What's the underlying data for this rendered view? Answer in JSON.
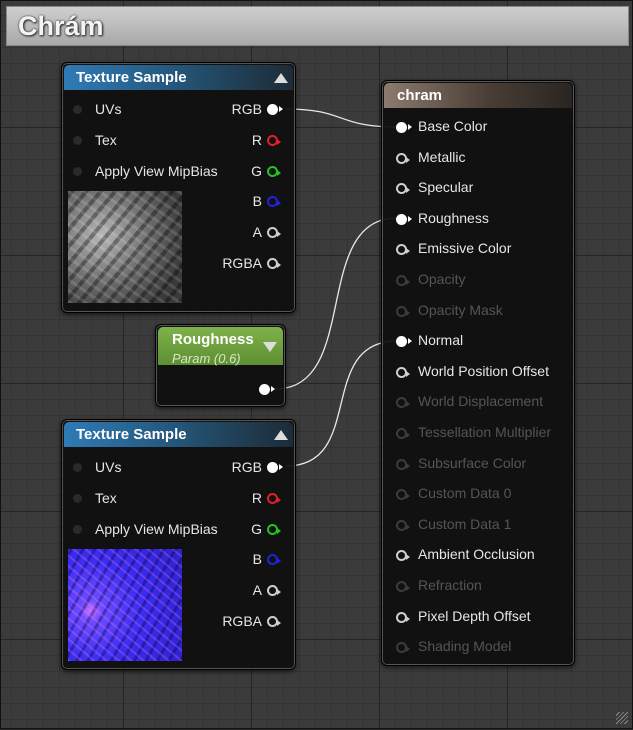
{
  "window": {
    "title": "Chrám"
  },
  "texture_sample_1": {
    "title": "Texture Sample",
    "inputs": [
      "UVs",
      "Tex",
      "Apply View MipBias"
    ],
    "outputs": [
      "RGB",
      "R",
      "G",
      "B",
      "A",
      "RGBA"
    ]
  },
  "roughness_param": {
    "title": "Roughness",
    "subtitle": "Param (0.6)"
  },
  "texture_sample_2": {
    "title": "Texture Sample",
    "inputs": [
      "UVs",
      "Tex",
      "Apply View MipBias"
    ],
    "outputs": [
      "RGB",
      "R",
      "G",
      "B",
      "A",
      "RGBA"
    ]
  },
  "material": {
    "title": "chram",
    "pins": [
      {
        "label": "Base Color",
        "enabled": true,
        "connected": true
      },
      {
        "label": "Metallic",
        "enabled": true,
        "connected": false
      },
      {
        "label": "Specular",
        "enabled": true,
        "connected": false
      },
      {
        "label": "Roughness",
        "enabled": true,
        "connected": true
      },
      {
        "label": "Emissive Color",
        "enabled": true,
        "connected": false
      },
      {
        "label": "Opacity",
        "enabled": false,
        "connected": false
      },
      {
        "label": "Opacity Mask",
        "enabled": false,
        "connected": false
      },
      {
        "label": "Normal",
        "enabled": true,
        "connected": true
      },
      {
        "label": "World Position Offset",
        "enabled": true,
        "connected": false
      },
      {
        "label": "World Displacement",
        "enabled": false,
        "connected": false
      },
      {
        "label": "Tessellation Multiplier",
        "enabled": false,
        "connected": false
      },
      {
        "label": "Subsurface Color",
        "enabled": false,
        "connected": false
      },
      {
        "label": "Custom Data 0",
        "enabled": false,
        "connected": false
      },
      {
        "label": "Custom Data 1",
        "enabled": false,
        "connected": false
      },
      {
        "label": "Ambient Occlusion",
        "enabled": true,
        "connected": false
      },
      {
        "label": "Refraction",
        "enabled": false,
        "connected": false
      },
      {
        "label": "Pixel Depth Offset",
        "enabled": true,
        "connected": false
      },
      {
        "label": "Shading Model",
        "enabled": false,
        "connected": false
      }
    ]
  },
  "colors": {
    "node_header_blue": "#2f7bb6",
    "param_header_green": "#7fb24a",
    "material_header": "#8c7b6e",
    "pin_red": "#e0202a",
    "pin_green": "#22c422",
    "pin_blue": "#2222dd"
  }
}
